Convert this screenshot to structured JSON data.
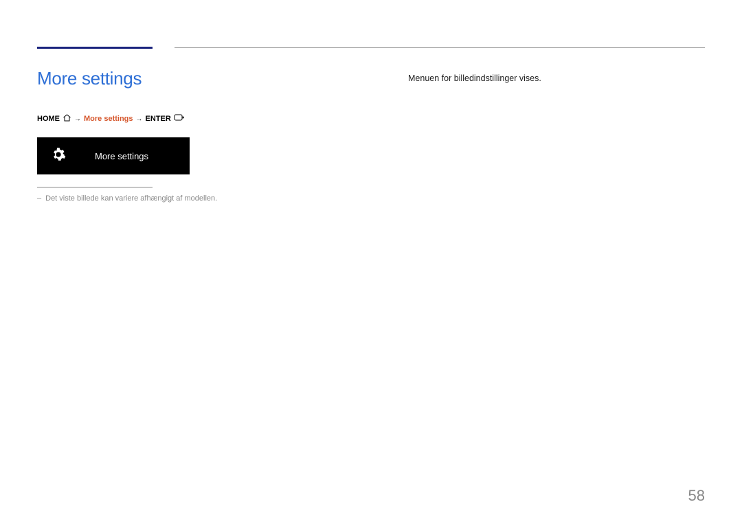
{
  "heading": "More settings",
  "breadcrumb": {
    "home": "HOME",
    "more": "More settings",
    "enter": "ENTER",
    "arrow": "→"
  },
  "black_box": {
    "label": "More settings"
  },
  "note": {
    "dash": "–",
    "text": "Det viste billede kan variere afhængigt af modellen."
  },
  "body": "Menuen for billedindstillinger vises.",
  "page_number": "58"
}
